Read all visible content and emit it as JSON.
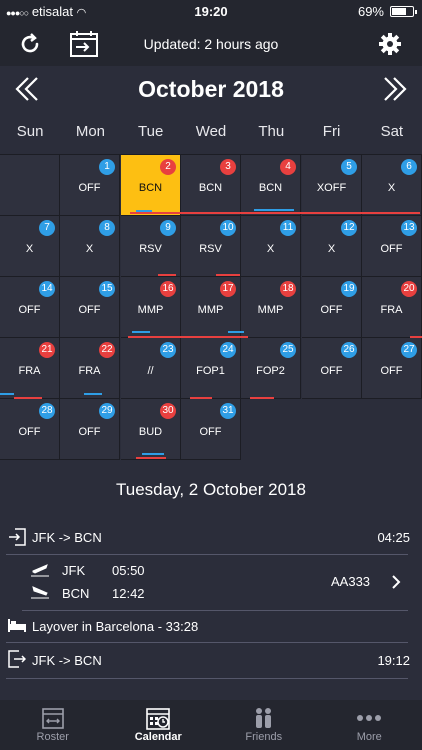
{
  "status": {
    "carrier": "etisalat",
    "time": "19:20",
    "battery": "69%"
  },
  "header": {
    "updated": "Updated: 2 hours ago"
  },
  "calendar": {
    "month": "October 2018",
    "weekdays": [
      "Sun",
      "Mon",
      "Tue",
      "Wed",
      "Thu",
      "Fri",
      "Sat"
    ],
    "days": [
      {
        "d": "1",
        "code": "OFF",
        "c": "blue"
      },
      {
        "d": "2",
        "code": "BCN",
        "c": "red",
        "sel": true
      },
      {
        "d": "3",
        "code": "BCN",
        "c": "red"
      },
      {
        "d": "4",
        "code": "BCN",
        "c": "red"
      },
      {
        "d": "5",
        "code": "XOFF",
        "c": "blue"
      },
      {
        "d": "6",
        "code": "X",
        "c": "blue"
      },
      {
        "d": "7",
        "code": "X",
        "c": "blue"
      },
      {
        "d": "8",
        "code": "X",
        "c": "blue"
      },
      {
        "d": "9",
        "code": "RSV",
        "c": "blue"
      },
      {
        "d": "10",
        "code": "RSV",
        "c": "blue"
      },
      {
        "d": "11",
        "code": "X",
        "c": "blue"
      },
      {
        "d": "12",
        "code": "X",
        "c": "blue"
      },
      {
        "d": "13",
        "code": "OFF",
        "c": "blue"
      },
      {
        "d": "14",
        "code": "OFF",
        "c": "blue"
      },
      {
        "d": "15",
        "code": "OFF",
        "c": "blue"
      },
      {
        "d": "16",
        "code": "MMP",
        "c": "red"
      },
      {
        "d": "17",
        "code": "MMP",
        "c": "red"
      },
      {
        "d": "18",
        "code": "MMP",
        "c": "red"
      },
      {
        "d": "19",
        "code": "OFF",
        "c": "blue"
      },
      {
        "d": "20",
        "code": "FRA",
        "c": "red"
      },
      {
        "d": "21",
        "code": "FRA",
        "c": "red"
      },
      {
        "d": "22",
        "code": "FRA",
        "c": "red"
      },
      {
        "d": "23",
        "code": "//",
        "c": "blue"
      },
      {
        "d": "24",
        "code": "FOP1",
        "c": "blue"
      },
      {
        "d": "25",
        "code": "FOP2",
        "c": "blue"
      },
      {
        "d": "26",
        "code": "OFF",
        "c": "blue"
      },
      {
        "d": "27",
        "code": "OFF",
        "c": "blue"
      },
      {
        "d": "28",
        "code": "OFF",
        "c": "blue"
      },
      {
        "d": "29",
        "code": "OFF",
        "c": "blue"
      },
      {
        "d": "30",
        "code": "BUD",
        "c": "red"
      },
      {
        "d": "31",
        "code": "OFF",
        "c": "blue"
      }
    ]
  },
  "detail": {
    "date": "Tuesday, 2 October 2018",
    "leg1": {
      "route": "JFK -> BCN",
      "time": "04:25"
    },
    "flight": {
      "dep_airport": "JFK",
      "dep_time": "05:50",
      "arr_airport": "BCN",
      "arr_time": "12:42",
      "number": "AA333"
    },
    "layover": "Layover in Barcelona - 33:28",
    "leg2": {
      "route": "JFK -> BCN",
      "time": "19:12"
    }
  },
  "tabs": [
    {
      "label": "Roster"
    },
    {
      "label": "Calendar"
    },
    {
      "label": "Friends"
    },
    {
      "label": "More"
    }
  ]
}
